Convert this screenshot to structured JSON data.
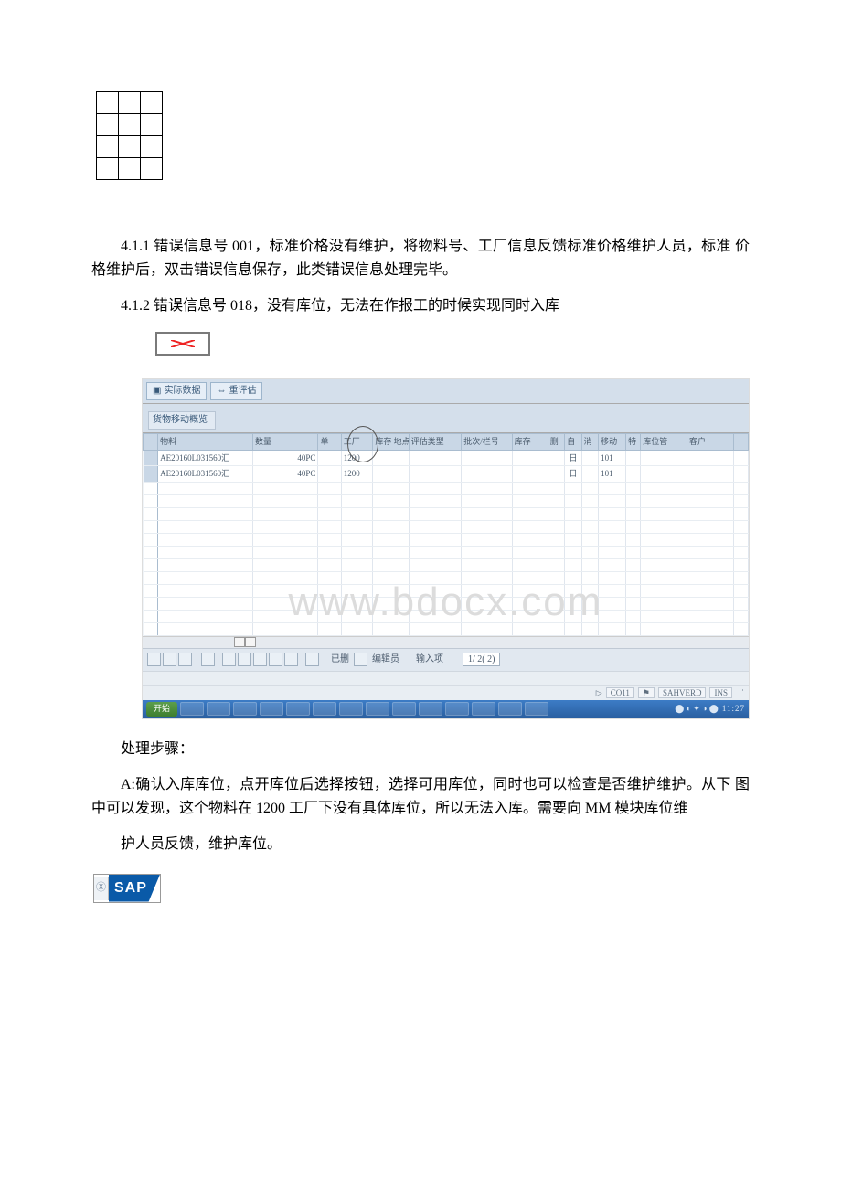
{
  "paragraphs": {
    "p1": "4.1.1 错误信息号 001，标准价格没有维护，将物料号、工厂信息反馈标准价格维护人员，标准 价格维护后，双击错误信息保存，此类错误信息处理完毕。",
    "p2": "4.1.2 错误信息号 018，没有库位，无法在作报工的时候实现同时入库",
    "p3": "处理步骤：",
    "p4": "A:确认入库库位，点开库位后选择按钮，选择可用库位，同时也可以检查是否维护维护。从下 图中可以发现，这个物料在 1200 工厂下没有具体库位，所以无法入库。需要向 MM 模块库位维",
    "p5": "护人员反馈，维护库位。"
  },
  "sap": {
    "tab1": "实际数据",
    "tab2": "重评估",
    "overviewTitle": "货物移动概览",
    "headers": {
      "marker": "",
      "material": "物料",
      "qty": "数量",
      "unit": "单",
      "plant": "工厂",
      "sloc": "库存 地点",
      "mvtype": "评估类型",
      "batch": "批次/栏号",
      "item": "库存",
      "c1": "删",
      "c2": "自",
      "c3": "消",
      "c4": "移动",
      "c5": "特",
      "c6": "库位管",
      "c7": "客户",
      "c8": ""
    },
    "rows": [
      {
        "material": "AE20160L031560汇",
        "qty": "40PC",
        "plant": "1200",
        "c2": "日",
        "c4": "101"
      },
      {
        "material": "AE20160L031560汇",
        "qty": "40PC",
        "plant": "1200",
        "c2": "日",
        "c4": "101"
      }
    ],
    "bottomToolbar": {
      "label1": "已删",
      "label2": "编辑员",
      "label3": "输入项",
      "field1": "1/ 2( 2)"
    },
    "statusBar": {
      "code": "CO11",
      "server": "SAHVERD",
      "ins": "INS"
    },
    "taskbar": {
      "start": "开始",
      "clock": "11:27"
    }
  },
  "watermark": "www.bdocx.com",
  "sapLogo": "SAP"
}
